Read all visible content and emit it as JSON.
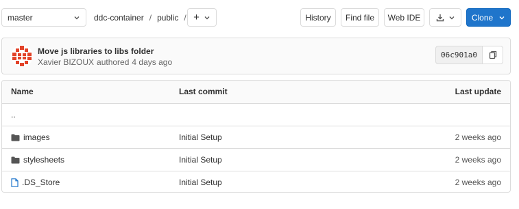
{
  "toolbar": {
    "branch": "master",
    "breadcrumb": {
      "project": "ddc-container",
      "sep1": "/",
      "folder": "public",
      "sep2": "/"
    },
    "add_label": "+",
    "history_label": "History",
    "find_file_label": "Find file",
    "web_ide_label": "Web IDE",
    "clone_label": "Clone"
  },
  "commit": {
    "title": "Move js libraries to libs folder",
    "author": "Xavier BIZOUX",
    "action": "authored",
    "time": "4 days ago",
    "sha": "06c901a0"
  },
  "table": {
    "headers": {
      "name": "Name",
      "last_commit": "Last commit",
      "last_update": "Last update"
    },
    "parent": "..",
    "rows": [
      {
        "type": "folder",
        "name": "images",
        "commit": "Initial Setup",
        "updated": "2 weeks ago"
      },
      {
        "type": "folder",
        "name": "stylesheets",
        "commit": "Initial Setup",
        "updated": "2 weeks ago"
      },
      {
        "type": "file",
        "name": ".DS_Store",
        "commit": "Initial Setup",
        "updated": "2 weeks ago"
      }
    ]
  },
  "icons": {
    "branch_dropdown": "chevron-down-icon",
    "add_dropdown": "chevron-down-icon",
    "download": "download-icon",
    "download_dropdown": "chevron-down-icon",
    "clone_dropdown": "chevron-down-icon",
    "copy": "copy-icon",
    "folder": "folder-icon",
    "file": "file-icon",
    "avatar": "avatar-icon"
  },
  "colors": {
    "primary": "#1f75cb",
    "border": "#dbdbdb",
    "file_icon": "#1f75cb",
    "folder_icon": "#555555",
    "avatar": "#e24329"
  }
}
